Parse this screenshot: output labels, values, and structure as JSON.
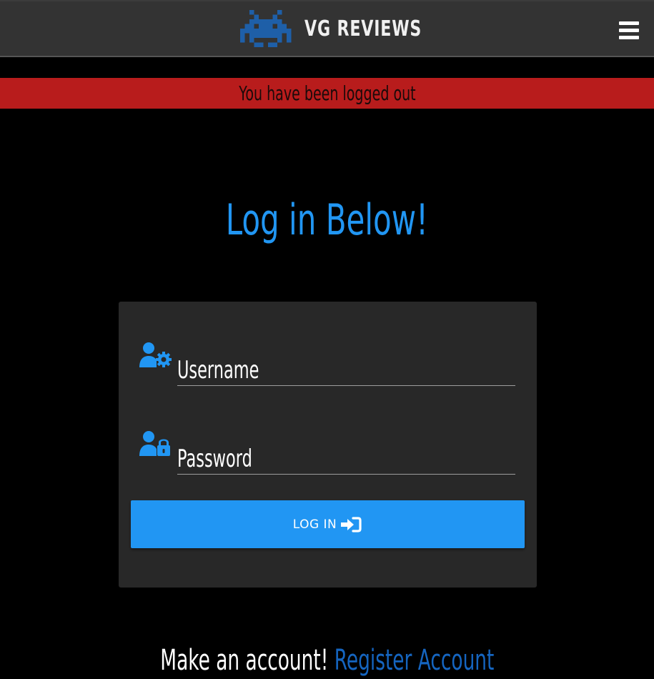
{
  "navbar": {
    "brand": "VG REVIEWS",
    "logo_icon": "space-invader-icon",
    "menu_icon": "hamburger-menu-icon"
  },
  "alert": {
    "message": "You have been logged out",
    "color": "#b81c1c"
  },
  "heading": "Log in Below!",
  "form": {
    "username": {
      "label": "Username",
      "value": "",
      "icon": "user-cog-icon"
    },
    "password": {
      "label": "Password",
      "value": "",
      "icon": "user-lock-icon"
    },
    "submit_label": "LOG IN",
    "submit_icon": "sign-in-icon"
  },
  "footer": {
    "prompt": "Make an account!",
    "link_label": "Register Account"
  },
  "colors": {
    "accent": "#2196f3",
    "navbar": "#333333",
    "card": "#282828",
    "background": "#000000"
  }
}
